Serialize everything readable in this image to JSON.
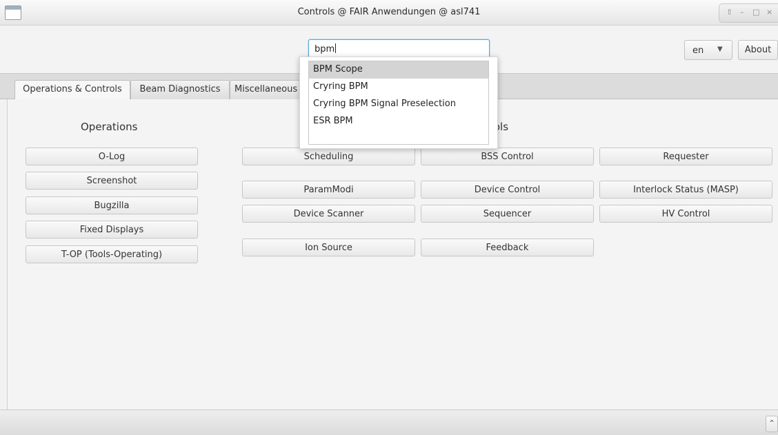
{
  "window": {
    "title": "Controls @ FAIR Anwendungen @ asl741",
    "controls": [
      "⇧",
      "–",
      "□",
      "×"
    ]
  },
  "toolbar": {
    "search_value": "bpm",
    "language": "en",
    "about_label": "About"
  },
  "dropdown": {
    "items": [
      "BPM Scope",
      "Cryring BPM",
      "Cryring BPM Signal Preselection",
      "ESR BPM"
    ],
    "selected_index": 0
  },
  "tabs": [
    {
      "label": "Operations & Controls",
      "active": true
    },
    {
      "label": "Beam Diagnostics",
      "active": false
    },
    {
      "label": "Miscellaneous",
      "active": false
    }
  ],
  "operations": {
    "heading": "Operations",
    "buttons": [
      "O-Log",
      "Screenshot",
      "Bugzilla",
      "Fixed Displays",
      "T-OP (Tools-Operating)"
    ]
  },
  "controls": {
    "heading": "Controls",
    "buttons": [
      "Scheduling",
      "BSS Control",
      "Requester",
      "ParamModi",
      "Device Control",
      "Interlock Status (MASP)",
      "Device Scanner",
      "Sequencer",
      "HV Control",
      "Ion Source",
      "Feedback"
    ]
  },
  "statusbar": {
    "collapse_icon": "⌃"
  }
}
